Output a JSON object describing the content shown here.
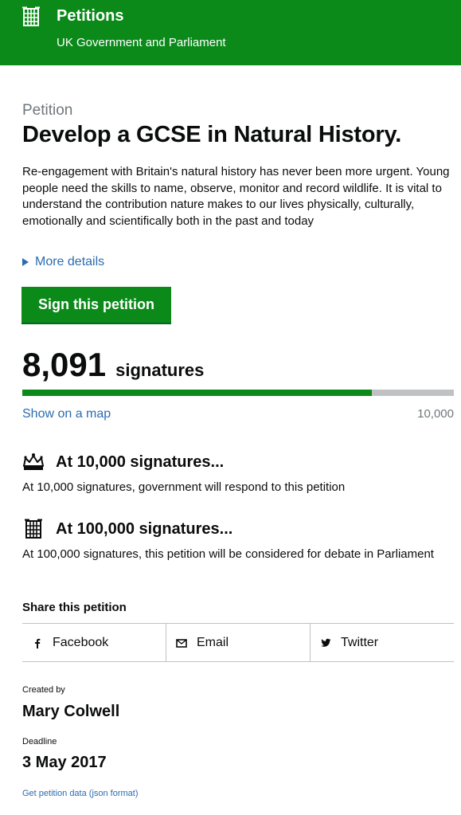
{
  "header": {
    "title": "Petitions",
    "subtitle": "UK Government and Parliament",
    "logo_icon": "portcullis-icon"
  },
  "petition": {
    "kicker": "Petition",
    "title": "Develop a GCSE in Natural History.",
    "summary": "Re-engagement with Britain's natural history has never been more urgent. Young people need the skills to name, observe, monitor and record wildlife. It is vital to understand the contribution nature makes to our lives physically, culturally, emotionally and scientifically both in the past and today",
    "more_details": "More details",
    "sign_button": "Sign this petition"
  },
  "signatures": {
    "count": "8,091",
    "label": "signatures",
    "progress_fraction": 0.8091,
    "show_map": "Show on a map",
    "target": "10,000"
  },
  "thresholds": [
    {
      "icon": "crown-icon",
      "heading": "At 10,000 signatures...",
      "text": "At 10,000 signatures, government will respond to this petition"
    },
    {
      "icon": "portcullis-icon",
      "heading": "At 100,000 signatures...",
      "text": "At 100,000 signatures, this petition will be considered for debate in Parliament"
    }
  ],
  "share": {
    "label": "Share this petition",
    "facebook": "Facebook",
    "email": "Email",
    "twitter": "Twitter"
  },
  "meta": {
    "created_label": "Created by",
    "created_value": "Mary Colwell",
    "deadline_label": "Deadline",
    "deadline_value": "3 May 2017",
    "json_link": "Get petition data (json format)"
  },
  "colors": {
    "brand_green": "#0b8a1a",
    "link_blue": "#2b6cb0",
    "progress_bg": "#bfc1c3"
  }
}
